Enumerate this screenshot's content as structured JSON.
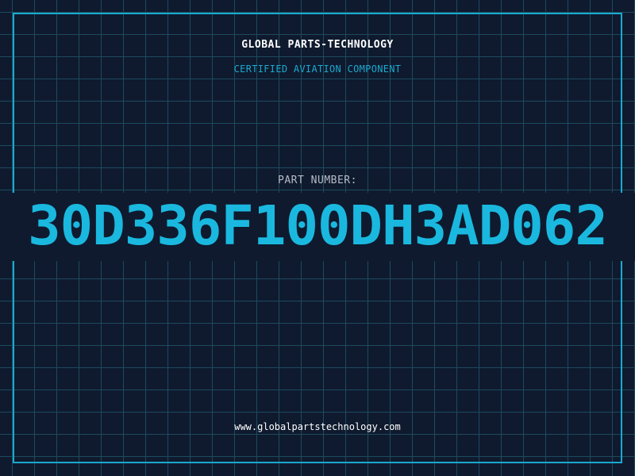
{
  "header": {
    "brand": "GLOBAL PARTS-TECHNOLOGY",
    "subtitle": "CERTIFIED AVIATION COMPONENT"
  },
  "part": {
    "label": "PART NUMBER:",
    "number": "30D336F100DH3AD062"
  },
  "footer": {
    "url": "www.globalpartstechnology.com"
  },
  "colors": {
    "background": "#0f1a2e",
    "grid": "#1d4a5e",
    "accent": "#1aa9cf",
    "text": "#ffffff"
  }
}
